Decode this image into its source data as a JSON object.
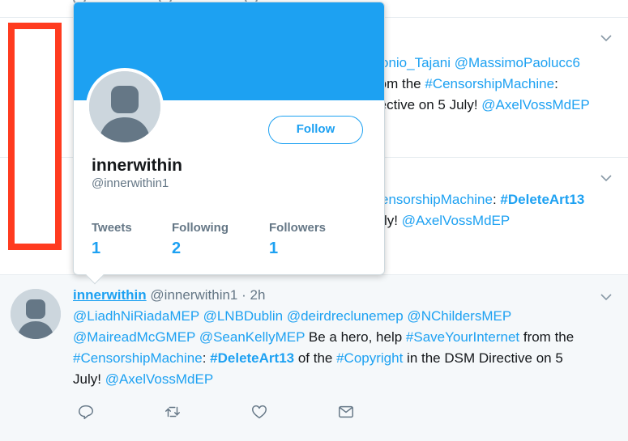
{
  "tweet_a": {
    "line1_mentions": "onio_Tajani @MassimoPaolucc6",
    "line2_prefix": "rom the ",
    "line2_hashtag": "#CensorshipMachine",
    "line2_suffix": ":",
    "line3_text": "rective on 5 July! ",
    "line3_mention": "@AxelVossMdEP"
  },
  "tweet_b": {
    "line1_hashtag": "ensorshipMachine",
    "line1_sep": ": ",
    "line1_bold_hashtag": "#DeleteArt13",
    "line2_text": "ly! ",
    "line2_mention": "@AxelVossMdEP"
  },
  "popover": {
    "display_name": "innerwithin",
    "handle": "@innerwithin1",
    "follow_label": "Follow",
    "stats": [
      {
        "label": "Tweets",
        "value": "1"
      },
      {
        "label": "Following",
        "value": "2"
      },
      {
        "label": "Followers",
        "value": "1"
      }
    ]
  },
  "tweet_c": {
    "display_name": "innerwithin",
    "handle": "@innerwithin1",
    "time": "· 2h",
    "line1": "@LiadhNiRiadaMEP @LNBDublin @deirdreclunemep @NChildersMEP",
    "line2_mentions": "@MaireadMcGMEP @SeanKellyMEP",
    "line2_text": " Be a hero, help ",
    "line2_hashtag": "#SaveYourInternet",
    "line2_tail": " from the",
    "line3_hashtag1": "#CensorshipMachine",
    "line3_sep": ": ",
    "line3_bold_hashtag": "#DeleteArt13",
    "line3_mid": " of the ",
    "line3_hashtag2": "#Copyright",
    "line3_tail": " in the DSM Directive on 5",
    "line4_text": "July! ",
    "line4_mention": "@AxelVossMdEP"
  },
  "icons": [
    "chevron-down-icon",
    "reply-icon",
    "retweet-icon",
    "like-icon",
    "message-icon"
  ],
  "colors": {
    "accent": "#1da1f2",
    "annotation": "#ff3b1f",
    "muted": "#657786"
  }
}
